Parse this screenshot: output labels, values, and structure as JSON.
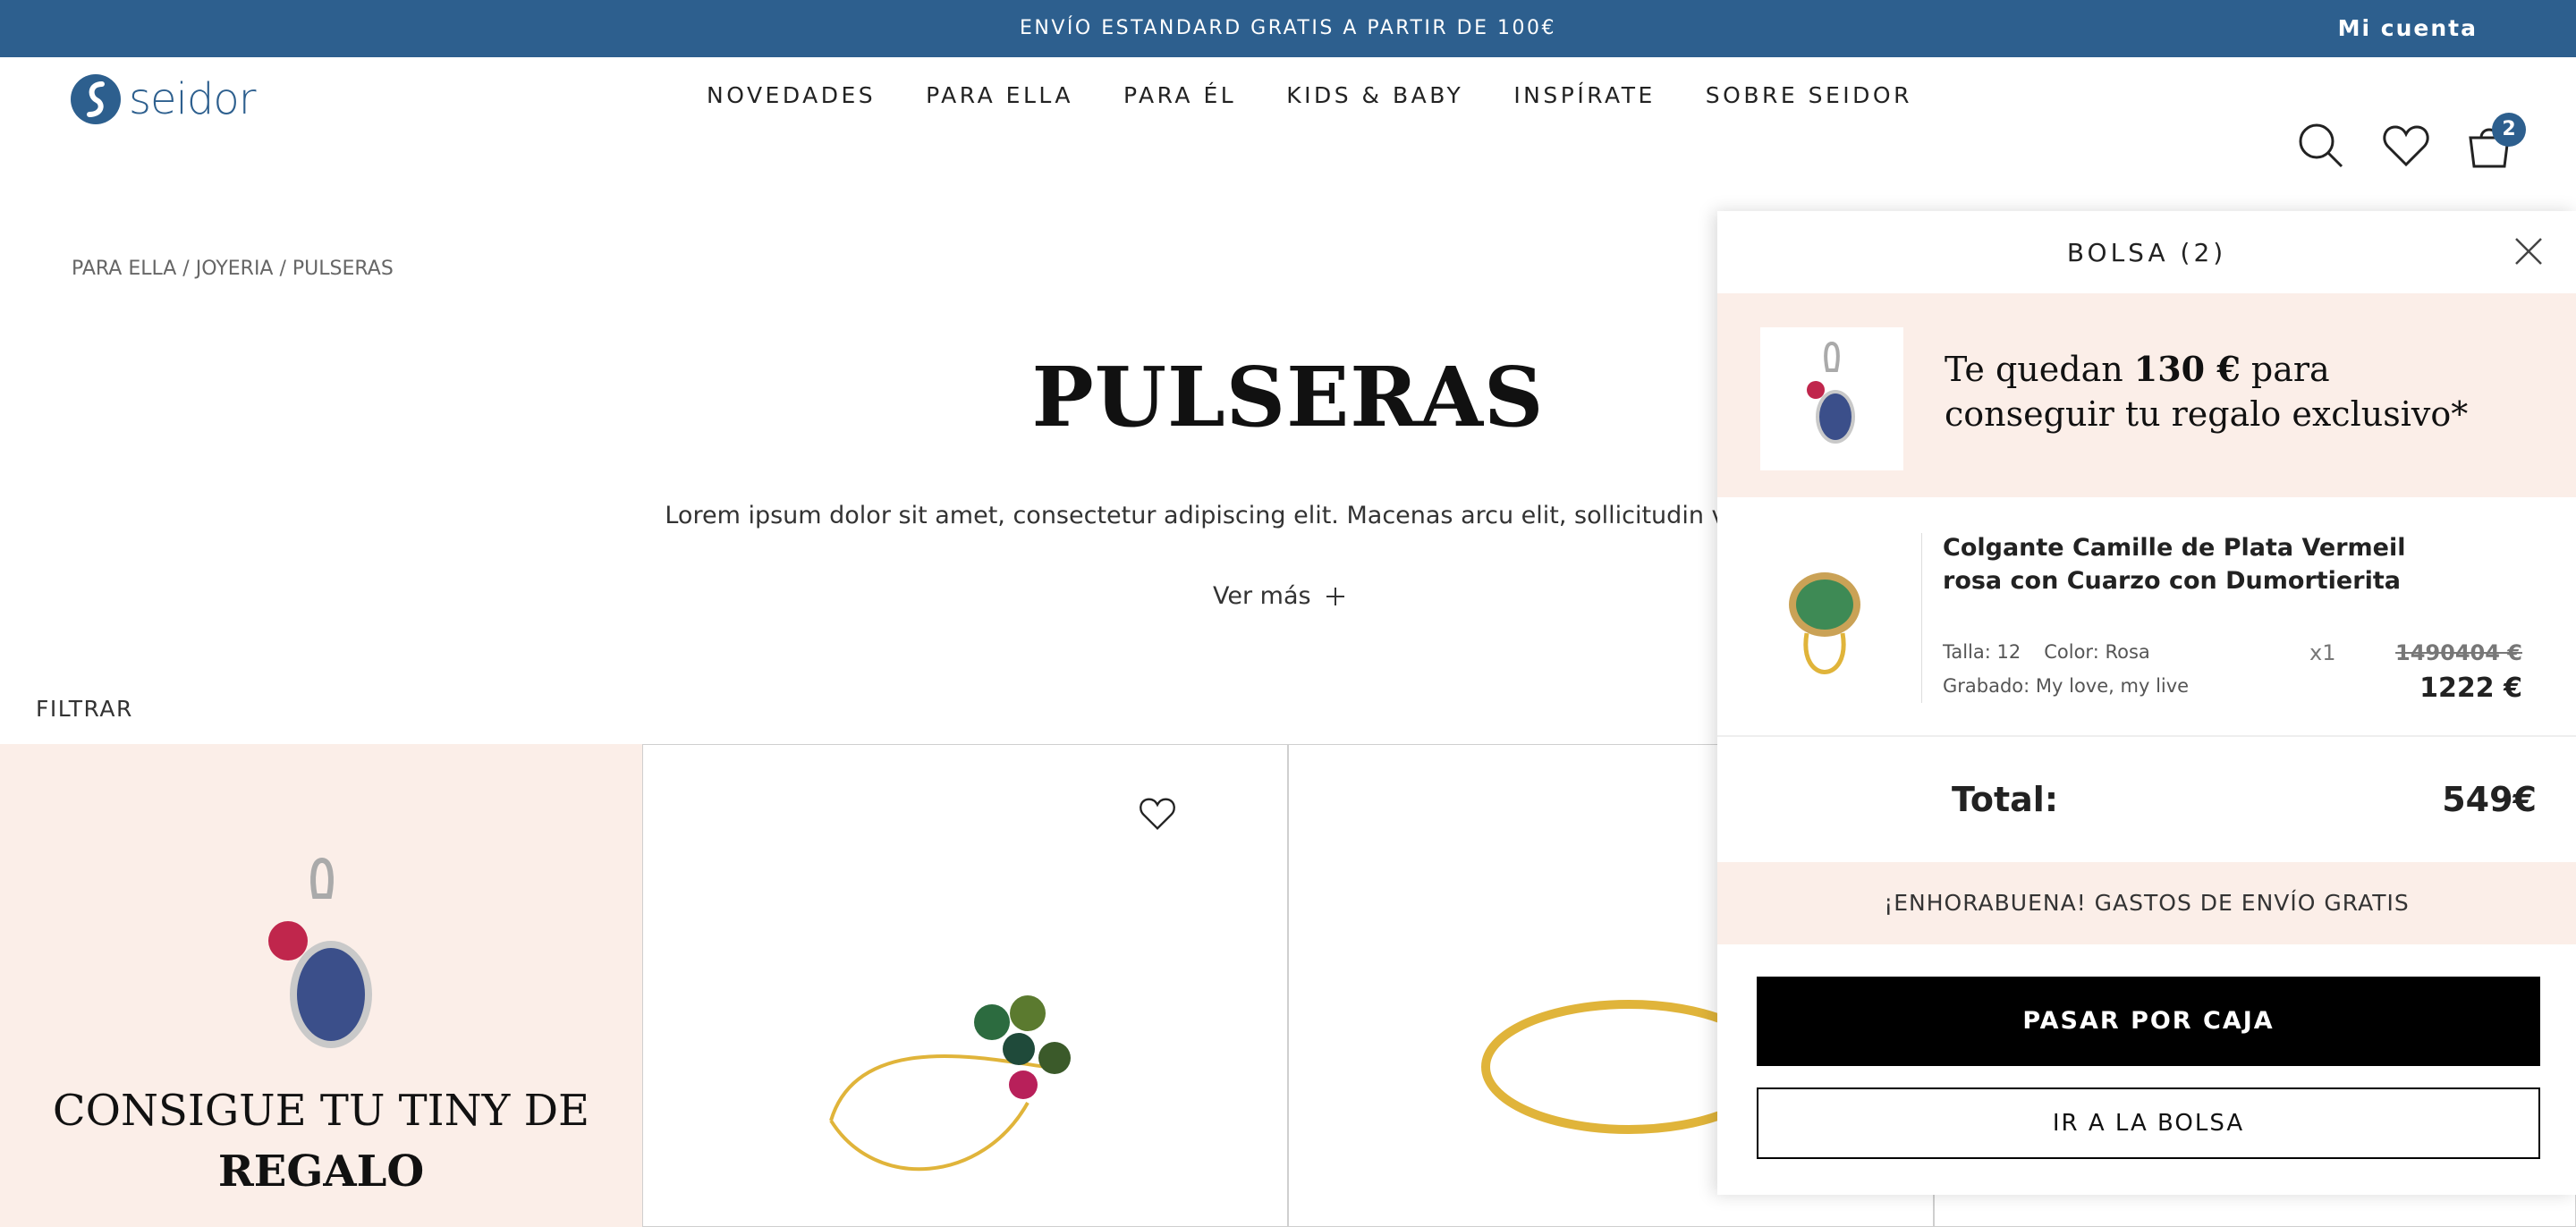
{
  "topbar": {
    "promo": "ENVÍO ESTANDARD GRATIS A PARTIR DE 100€",
    "account": "Mi cuenta"
  },
  "brand": {
    "logo_text": "seidor",
    "accent": "#2d5f8e"
  },
  "nav": [
    "NOVEDADES",
    "PARA ELLA",
    "PARA ÉL",
    "KIDS & BABY",
    "INSPÍRATE",
    "SOBRE SEIDOR"
  ],
  "header_icons": {
    "search": "search-icon",
    "wishlist": "heart-icon",
    "bag": "bag-icon",
    "bag_count": "2"
  },
  "breadcrumb": "PARA ELLA / JOYERIA / PULSERAS",
  "page": {
    "title": "PULSERAS",
    "description": "Lorem ipsum dolor sit amet, consectetur adipiscing elit. Macenas arcu elit, sollicitudin vitae sagittis sit.",
    "ver_mas": "Ver  más",
    "filter": "FILTRAR"
  },
  "promo_card": {
    "line1": "CONSIGUE TU TINY DE",
    "line2": "REGALO",
    "bg": "#fbeee8"
  },
  "drawer": {
    "title": "BOLSA (2)",
    "gift": {
      "prefix": "Te quedan ",
      "amount": "130 €",
      "suffix": " para conseguir tu regalo exclusivo*"
    },
    "item": {
      "name": "Colgante Camille de Plata Vermeil rosa con Cuarzo con Dumortierita",
      "size": "Talla: 12",
      "color": "Color: Rosa",
      "engraving": "Grabado: My love, my live",
      "qty": "x1",
      "old_price": "1490404 €",
      "price": "1222 €"
    },
    "total_label": "Total:",
    "total_value": "549€",
    "free_shipping": "¡ENHORABUENA! GASTOS DE ENVÍO GRATIS",
    "checkout": "PASAR POR CAJA",
    "go_to_bag": "IR A LA BOLSA"
  }
}
